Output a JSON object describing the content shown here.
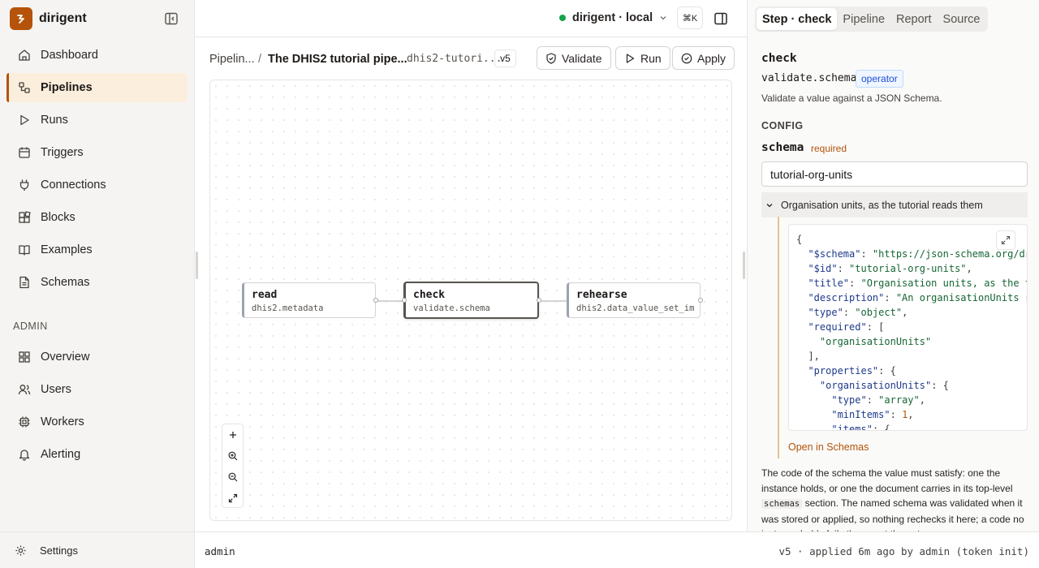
{
  "app": {
    "name": "dirigent"
  },
  "sidebar": {
    "items": [
      {
        "label": "Dashboard",
        "icon": "home-icon"
      },
      {
        "label": "Pipelines",
        "icon": "pipelines-icon",
        "active": true
      },
      {
        "label": "Runs",
        "icon": "play-icon"
      },
      {
        "label": "Triggers",
        "icon": "calendar-icon"
      },
      {
        "label": "Connections",
        "icon": "plug-icon"
      },
      {
        "label": "Blocks",
        "icon": "blocks-icon"
      },
      {
        "label": "Examples",
        "icon": "book-icon"
      },
      {
        "label": "Schemas",
        "icon": "document-icon"
      }
    ],
    "admin_label": "ADMIN",
    "admin_items": [
      {
        "label": "Overview",
        "icon": "grid-icon"
      },
      {
        "label": "Users",
        "icon": "users-icon"
      },
      {
        "label": "Workers",
        "icon": "cpu-icon"
      },
      {
        "label": "Alerting",
        "icon": "bell-icon"
      }
    ],
    "settings_label": "Settings"
  },
  "topbar": {
    "environment": "dirigent · local",
    "environment_status_color": "#16a34a",
    "shortcut": "⌘K"
  },
  "crumbs": {
    "parent": "Pipelin...",
    "separator": "/",
    "current": "The DHIS2 tutorial pipe...",
    "slug": "dhis2-tutori...",
    "version": "v5"
  },
  "actions": {
    "validate": "Validate",
    "run": "Run",
    "apply": "Apply"
  },
  "nodes": [
    {
      "title": "read",
      "subtitle": "dhis2.metadata"
    },
    {
      "title": "check",
      "subtitle": "validate.schema",
      "selected": true
    },
    {
      "title": "rehearse",
      "subtitle": "dhis2.data_value_set_im..."
    }
  ],
  "status": {
    "user": "admin",
    "meta": "v5 · applied 6m ago by admin (token init)"
  },
  "panel": {
    "tabs": [
      "Step · check",
      "Pipeline",
      "Report",
      "Source"
    ],
    "active_tab": "Step · check",
    "step_name": "check",
    "operator": "validate.schema",
    "operator_badge": "operator",
    "description": "Validate a value against a JSON Schema.",
    "config_label": "CONFIG",
    "field_name": "schema",
    "field_required": "required",
    "field_value": "tutorial-org-units",
    "disclosure_label": "Organisation units, as the tutorial reads them",
    "code_lines": [
      "{",
      "  \"$schema\": \"https://json-schema.org/dr",
      "  \"$id\": \"tutorial-org-units\",",
      "  \"title\": \"Organisation units, as the t",
      "  \"description\": \"An organisationUnits r",
      "  \"type\": \"object\",",
      "  \"required\": [",
      "    \"organisationUnits\"",
      "  ],",
      "  \"properties\": {",
      "    \"organisationUnits\": {",
      "      \"type\": \"array\",",
      "      \"minItems\": 1,",
      "      \"items\": {"
    ],
    "open_link": "Open in Schemas",
    "help_part1": "The code of the schema the value must satisfy: one the instance holds, or one the document carries in its top-level",
    "help_code": "schemas",
    "help_part2": "section. The named schema was validated when it was stored or applied, so nothing rechecks it here; a code no instance holds fails the run at the gate."
  },
  "colors": {
    "accent": "#b45309",
    "active_bg": "#fbeedc",
    "badge": "#1d4ed8"
  }
}
